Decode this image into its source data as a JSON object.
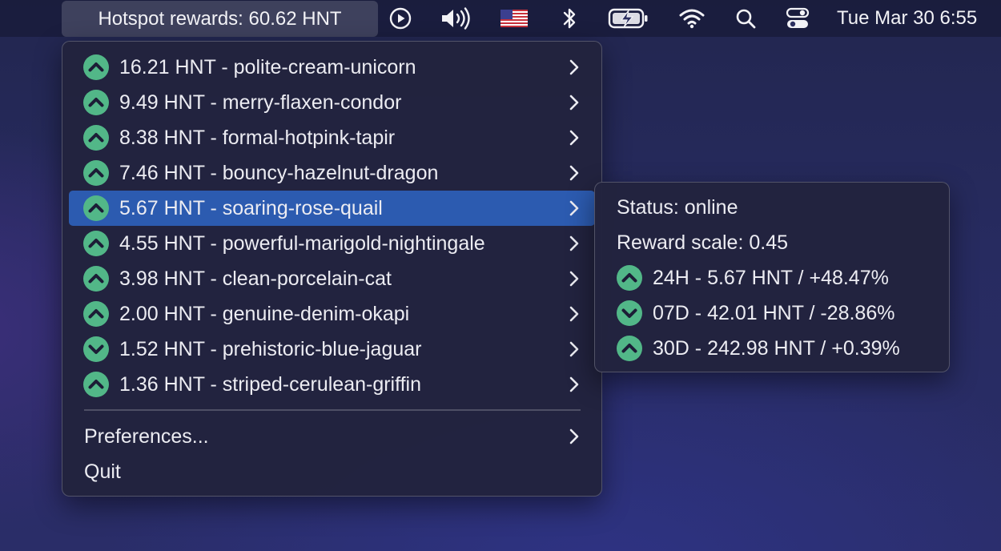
{
  "menubar": {
    "app_title": "Hotspot rewards: 60.62 HNT",
    "icons": [
      "play-circle-icon",
      "volume-icon",
      "us-flag-icon",
      "bluetooth-icon",
      "battery-charging-icon",
      "wifi-icon",
      "search-icon",
      "control-center-icon"
    ],
    "clock": "Tue Mar 30  6:55"
  },
  "hotspots": [
    {
      "label": "16.21 HNT - polite-cream-unicorn",
      "trend": "up"
    },
    {
      "label": "9.49 HNT - merry-flaxen-condor",
      "trend": "up"
    },
    {
      "label": "8.38 HNT - formal-hotpink-tapir",
      "trend": "up"
    },
    {
      "label": "7.46 HNT - bouncy-hazelnut-dragon",
      "trend": "up"
    },
    {
      "label": "5.67 HNT - soaring-rose-quail",
      "trend": "up",
      "selected": true
    },
    {
      "label": "4.55 HNT - powerful-marigold-nightingale",
      "trend": "up"
    },
    {
      "label": "3.98 HNT - clean-porcelain-cat",
      "trend": "up"
    },
    {
      "label": "2.00 HNT - genuine-denim-okapi",
      "trend": "up"
    },
    {
      "label": "1.52 HNT - prehistoric-blue-jaguar",
      "trend": "down"
    },
    {
      "label": "1.36 HNT - striped-cerulean-griffin",
      "trend": "up"
    }
  ],
  "menu": {
    "preferences": "Preferences...",
    "quit": "Quit"
  },
  "submenu": {
    "status": "Status: online",
    "reward_scale": "Reward scale: 0.45",
    "periods": [
      {
        "label": "24H - 5.67 HNT / +48.47%",
        "trend": "up"
      },
      {
        "label": "07D - 42.01 HNT / -28.86%",
        "trend": "down"
      },
      {
        "label": "30D - 242.98 HNT / +0.39%",
        "trend": "up"
      }
    ]
  },
  "colors": {
    "badge_green": "#52b788",
    "selection_blue": "#2c5bb0",
    "menu_bg": "#22233e"
  }
}
